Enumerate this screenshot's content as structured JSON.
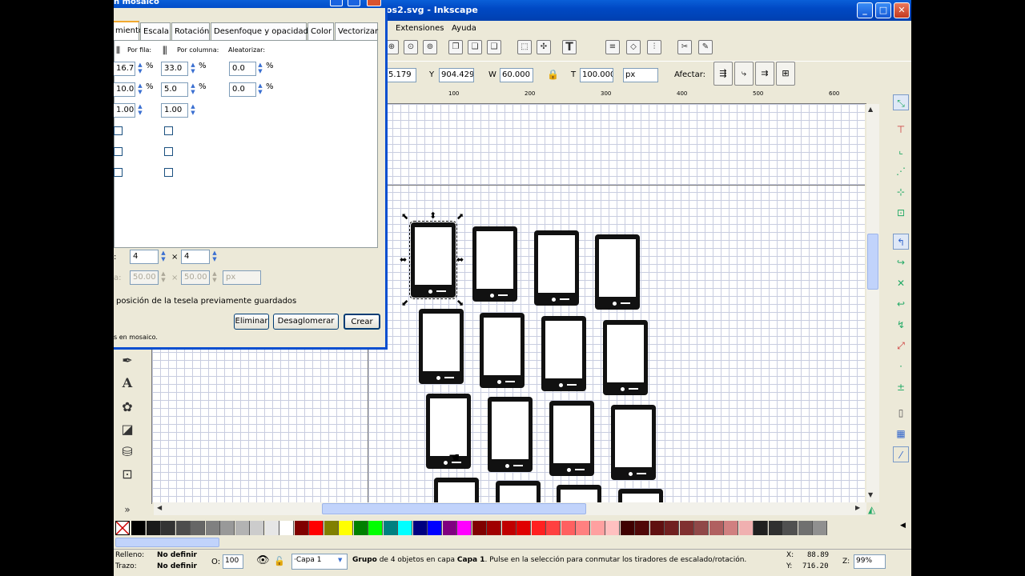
{
  "window": {
    "title": "os2.svg - Inkscape",
    "minimize": "_",
    "maximize": "□",
    "close": "✕"
  },
  "menu": {
    "extensions": "Extensiones",
    "help": "Ayuda"
  },
  "toolbar2": {
    "x_value": "5.179",
    "y_label": "Y",
    "y_value": "904.429",
    "w_label": "W",
    "w_value": "60.000",
    "h_label": "T",
    "h_value": "100.000",
    "unit": "px",
    "affect_label": "Afectar:"
  },
  "ruler": {
    "ticks": [
      "100",
      "200",
      "300",
      "400",
      "500",
      "600"
    ]
  },
  "dialog": {
    "title": "n mosaico",
    "tabs": [
      "miento",
      "Escala",
      "Rotación",
      "Desenfoque y opacidad",
      "Color",
      "Vectorizar"
    ],
    "col_row_label": "Por fila:",
    "col_column_label": "Por columna:",
    "col_random_label": "Aleatorizar:",
    "rows": [
      {
        "a": "16.7",
        "b": "33.0",
        "c": "0.0",
        "unit": "%"
      },
      {
        "a": "10.0",
        "b": "5.0",
        "c": "0.0",
        "unit": "%"
      },
      {
        "a": "1.00",
        "b": "1.00"
      }
    ],
    "rows_count": "4",
    "cols_count": "4",
    "times": "×",
    "width_value": "50.00",
    "height_value": "50.00",
    "size_unit": "px",
    "hint": "posición de la tesela previamente guardados",
    "status": "s en mosaico.",
    "btn_delete": "Eliminar",
    "btn_unclump": "Desaglomerar",
    "btn_create": "Crear"
  },
  "status": {
    "fill_label": "Relleno:",
    "fill_value": "No definir",
    "stroke_label": "Trazo:",
    "stroke_value": "No definir",
    "opacity_label": "O:",
    "opacity_value": "100",
    "layer": "·Capa 1",
    "message_pre": "Grupo",
    "message_mid": " de 4 objetos en capa ",
    "message_layer": "Capa 1",
    "message_post": ". Pulse en la selección para conmutar los tiradores de escalado/rotación.",
    "x_label": "X:",
    "x_value": "88.89",
    "y_label": "Y:",
    "y_value": "716.20",
    "zoom_label": "Z:",
    "zoom_value": "99%"
  },
  "palette": [
    "#000000",
    "#1a1a1a",
    "#333333",
    "#4d4d4d",
    "#666666",
    "#808080",
    "#999999",
    "#b3b3b3",
    "#cccccc",
    "#e6e6e6",
    "#ffffff",
    "#800000",
    "#ff0000",
    "#808000",
    "#ffff00",
    "#008000",
    "#00ff00",
    "#008080",
    "#00ffff",
    "#000080",
    "#0000ff",
    "#800080",
    "#ff00ff",
    "#800000",
    "#a00000",
    "#c00000",
    "#e00000",
    "#ff2020",
    "#ff4040",
    "#ff6060",
    "#ff8080",
    "#ffa0a0",
    "#ffc0c0",
    "#400000",
    "#500808",
    "#601010",
    "#702020",
    "#803030",
    "#904848",
    "#b06060",
    "#d08080",
    "#f0b0b0",
    "#202020",
    "#303030",
    "#505050",
    "#707070",
    "#909090"
  ]
}
